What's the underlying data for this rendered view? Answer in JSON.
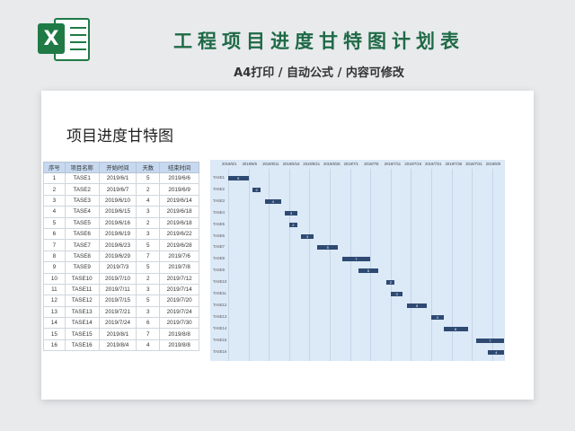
{
  "header": {
    "logo_letter": "X",
    "title": "工程项目进度甘特图计划表",
    "subtitle": "A4打印 / 自动公式 / 内容可修改"
  },
  "sheet": {
    "title": "项目进度甘特图",
    "columns": [
      "序号",
      "项目名称",
      "开始时间",
      "天数",
      "结束时间"
    ],
    "rows": [
      [
        "1",
        "TASE1",
        "2019/6/1",
        "5",
        "2019/6/6"
      ],
      [
        "2",
        "TASE2",
        "2019/6/7",
        "2",
        "2019/6/9"
      ],
      [
        "3",
        "TASE3",
        "2019/6/10",
        "4",
        "2019/6/14"
      ],
      [
        "4",
        "TASE4",
        "2019/6/15",
        "3",
        "2019/6/18"
      ],
      [
        "5",
        "TASE5",
        "2019/6/16",
        "2",
        "2019/6/18"
      ],
      [
        "6",
        "TASE6",
        "2019/6/19",
        "3",
        "2019/6/22"
      ],
      [
        "7",
        "TASE7",
        "2019/6/23",
        "5",
        "2019/6/28"
      ],
      [
        "8",
        "TASE8",
        "2019/6/29",
        "7",
        "2019/7/6"
      ],
      [
        "9",
        "TASE9",
        "2019/7/3",
        "5",
        "2019/7/8"
      ],
      [
        "10",
        "TASE10",
        "2019/7/10",
        "2",
        "2019/7/12"
      ],
      [
        "11",
        "TASE11",
        "2019/7/11",
        "3",
        "2019/7/14"
      ],
      [
        "12",
        "TASE12",
        "2019/7/15",
        "5",
        "2019/7/20"
      ],
      [
        "13",
        "TASE13",
        "2019/7/21",
        "3",
        "2019/7/24"
      ],
      [
        "14",
        "TASE14",
        "2019/7/24",
        "6",
        "2019/7/30"
      ],
      [
        "15",
        "TASE15",
        "2019/8/1",
        "7",
        "2019/8/8"
      ],
      [
        "16",
        "TASE16",
        "2019/8/4",
        "4",
        "2019/8/8"
      ]
    ]
  },
  "gantt": {
    "date_headers": [
      "2019/6/1",
      "2019/6/6",
      "2019/6/11",
      "2019/6/16",
      "2019/6/21",
      "2019/6/26",
      "2019/7/1",
      "2019/7/6",
      "2019/7/11",
      "2019/7/16",
      "2019/7/21",
      "2019/7/26",
      "2019/7/31",
      "2019/8/5"
    ],
    "bar_color": "#2e4a72",
    "background_color": "#dce9f7"
  }
}
